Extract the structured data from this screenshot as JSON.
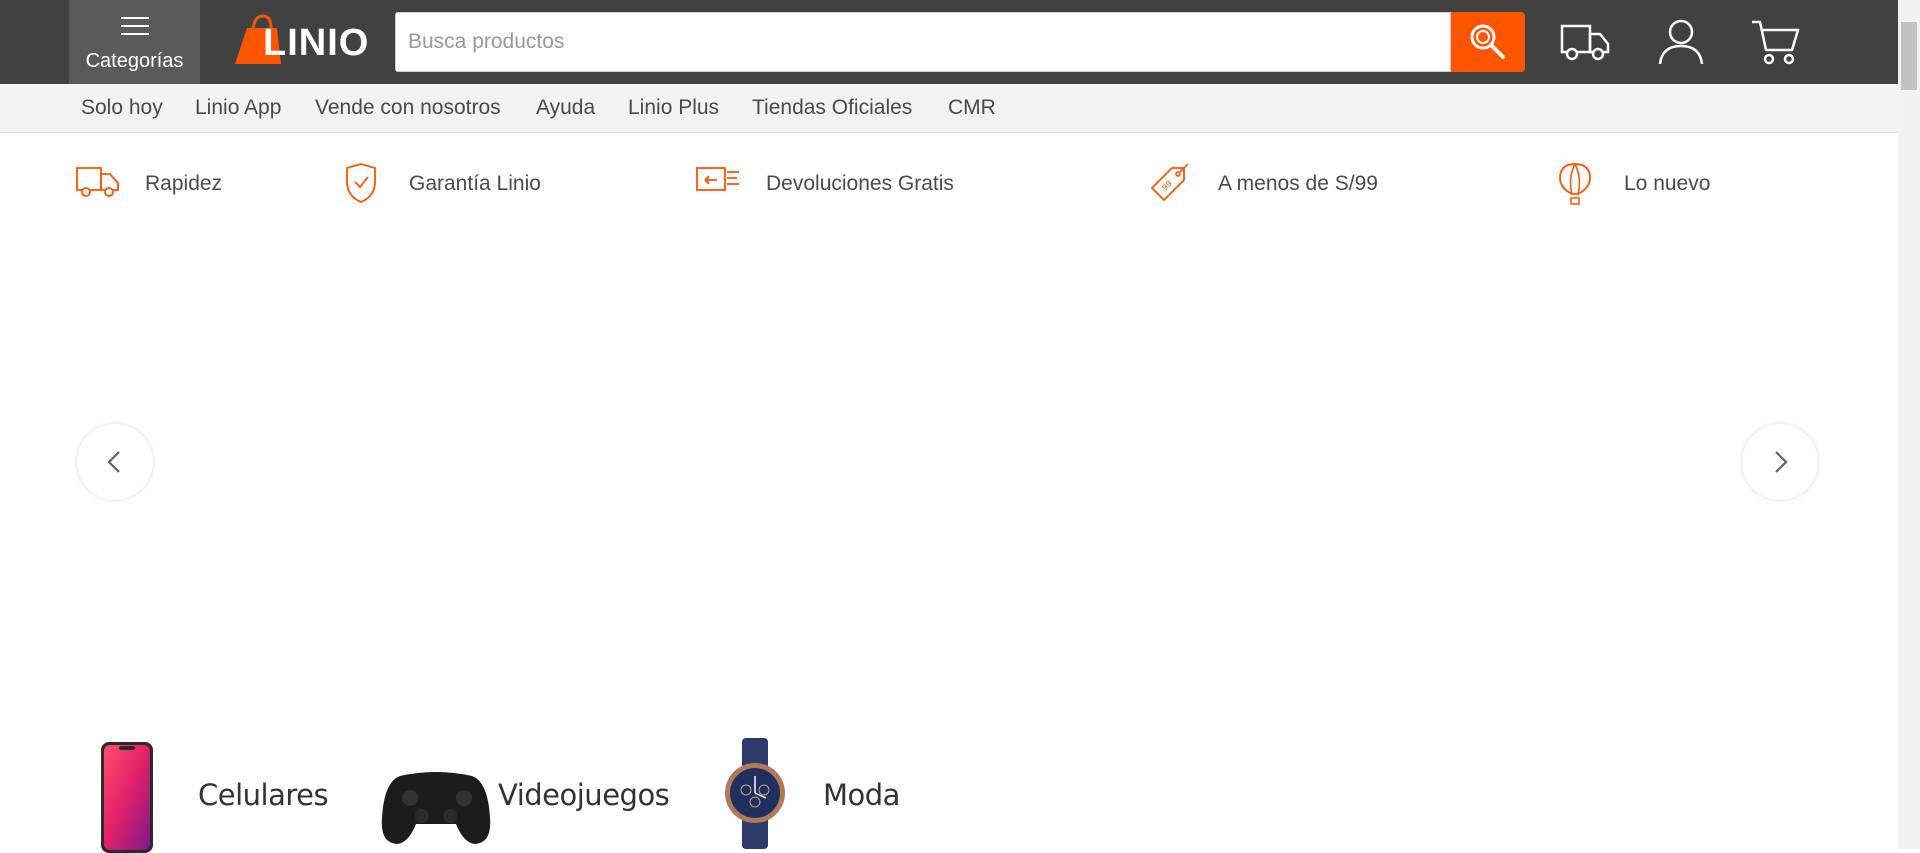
{
  "header": {
    "categories_label": "Categorías",
    "logo_text": "LINIO",
    "search_placeholder": "Busca productos",
    "icons": [
      "menu-icon",
      "search-icon",
      "delivery-truck-icon",
      "user-icon",
      "cart-icon"
    ]
  },
  "subnav": {
    "items": [
      "Solo hoy",
      "Linio App",
      "Vende con nosotros",
      "Ayuda",
      "Linio Plus",
      "Tiendas Oficiales",
      "CMR"
    ]
  },
  "features": [
    {
      "label": "Rapidez",
      "icon": "truck-icon"
    },
    {
      "label": "Garantía Linio",
      "icon": "shield-check-icon"
    },
    {
      "label": "Devoluciones Gratis",
      "icon": "return-box-icon"
    },
    {
      "label": "A menos de S/99",
      "icon": "price-tag-icon"
    },
    {
      "label": "Lo nuevo",
      "icon": "hot-air-balloon-icon"
    }
  ],
  "carousel": {
    "prev_icon": "chevron-left-icon",
    "next_icon": "chevron-right-icon"
  },
  "categories": [
    {
      "label": "Celulares",
      "icon": "smartphone-image"
    },
    {
      "label": "Videojuegos",
      "icon": "gamepad-image"
    },
    {
      "label": "Moda",
      "icon": "watch-image"
    }
  ],
  "colors": {
    "accent": "#ff5500",
    "header_bg": "#414141",
    "subnav_bg": "#f2f2f2",
    "text": "#4a4a4a"
  }
}
